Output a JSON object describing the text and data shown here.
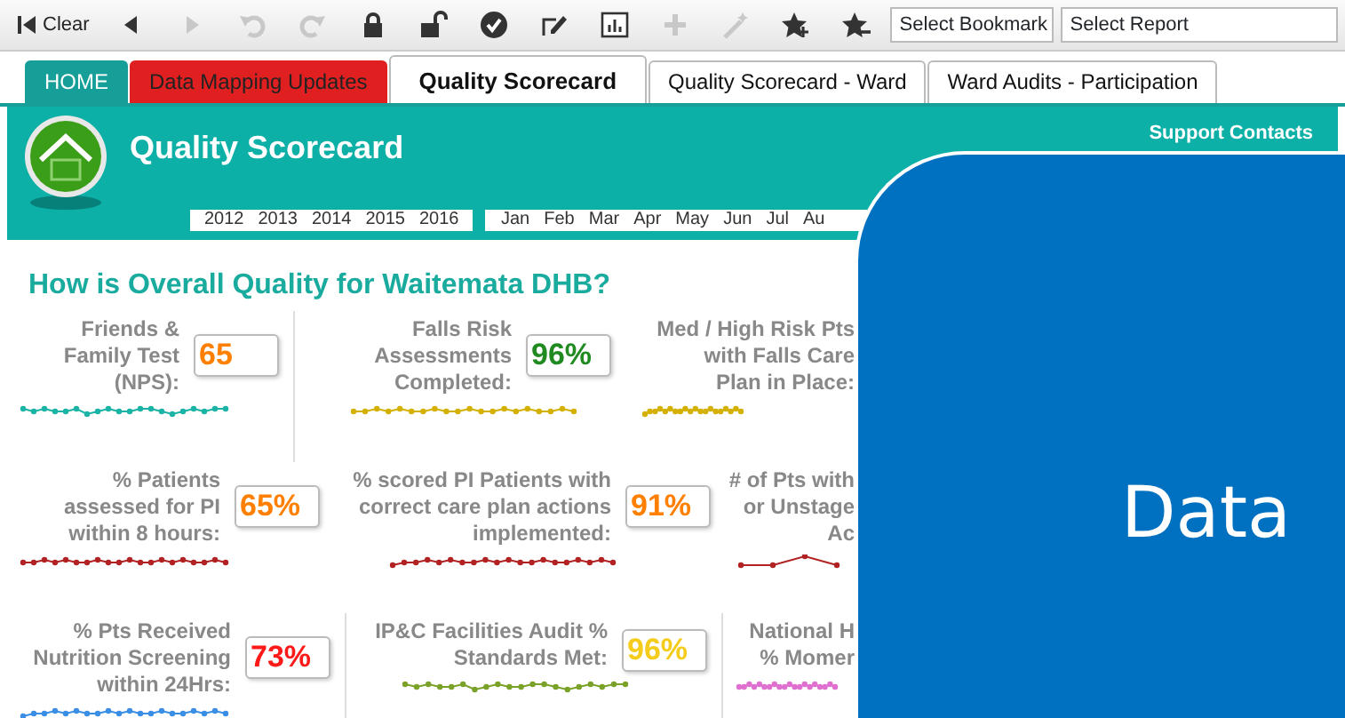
{
  "toolbar": {
    "clear_label": "Clear",
    "tools": [
      {
        "kind": "back",
        "disabled": false
      },
      {
        "kind": "forward",
        "disabled": true
      },
      {
        "kind": "undo",
        "disabled": true
      },
      {
        "kind": "redo",
        "disabled": true
      },
      {
        "kind": "lock",
        "disabled": false
      },
      {
        "kind": "unlock",
        "disabled": false
      },
      {
        "kind": "check",
        "disabled": false
      },
      {
        "kind": "edit",
        "disabled": false
      },
      {
        "kind": "chart",
        "disabled": false
      },
      {
        "kind": "plus",
        "disabled": true
      },
      {
        "kind": "wand",
        "disabled": true
      },
      {
        "kind": "star-add",
        "disabled": false
      },
      {
        "kind": "star-remove",
        "disabled": false
      }
    ],
    "bookmark_select": "Select Bookmark",
    "report_select": "Select Report"
  },
  "tabs": [
    {
      "label": "HOME",
      "selected": false,
      "color": "#169e98"
    },
    {
      "label": "Data Mapping Updates",
      "selected": false,
      "color": "#e02020"
    },
    {
      "label": "Quality Scorecard",
      "selected": true
    },
    {
      "label": "Quality Scorecard - Ward",
      "selected": false
    },
    {
      "label": "Ward Audits - Participation",
      "selected": false
    }
  ],
  "header": {
    "title": "Quality Scorecard",
    "support_link": "Support Contacts",
    "years": [
      "2012",
      "2013",
      "2014",
      "2015",
      "2016"
    ],
    "months": [
      "Jan",
      "Feb",
      "Mar",
      "Apr",
      "May",
      "Jun",
      "Jul",
      "Au"
    ]
  },
  "heading": "How is Overall Quality for Waitemata DHB?",
  "kpi_rows": [
    [
      {
        "label": [
          "Friends &",
          "Family Test",
          "(NPS):"
        ],
        "value": {
          "text": "65",
          "color": "#ff7f00"
        },
        "sparkline": {
          "color": "#1ab3a6"
        }
      },
      {
        "label": [
          "Falls Risk",
          "Assessments",
          "Completed:"
        ],
        "value": {
          "text": "96%",
          "color": "#218a21"
        },
        "sparkline": {
          "color": "#d4b000"
        }
      },
      {
        "label": [
          "Med / High Risk Pts",
          "with Falls Care",
          "Plan in Place:"
        ],
        "sparkline": {
          "color": "#d4b000"
        }
      }
    ],
    [
      {
        "label": [
          "% Patients",
          "assessed for PI",
          "within 8 hours:"
        ],
        "value": {
          "text": "65%",
          "color": "#ff7f00"
        },
        "sparkline": {
          "color": "#b22222"
        }
      },
      {
        "label": [
          "% scored PI Patients with",
          "correct care plan actions",
          "implemented:"
        ],
        "value": {
          "text": "91%",
          "color": "#ff7f00"
        },
        "sparkline": {
          "color": "#b22222"
        }
      },
      {
        "label": [
          "# of Pts with",
          "or Unstage",
          "Ac"
        ],
        "sparkline": {
          "color": "#b22222"
        }
      }
    ],
    [
      {
        "label": [
          "% Pts Received",
          "Nutrition Screening",
          "within 24Hrs:"
        ],
        "value": {
          "text": "73%",
          "color": "#ff1a1a"
        },
        "sparkline": {
          "color": "#3a8ee6"
        }
      },
      {
        "label": [
          "IP&C Facilities Audit %",
          "Standards Met:"
        ],
        "value": {
          "text": "96%",
          "color": "#f5cc1a"
        },
        "sparkline": {
          "color": "#7aa228"
        }
      },
      {
        "label": [
          "National H",
          "% Momer"
        ],
        "sparkline": {
          "color": "#e070d0"
        }
      }
    ]
  ],
  "overlay": {
    "text": "Data"
  }
}
